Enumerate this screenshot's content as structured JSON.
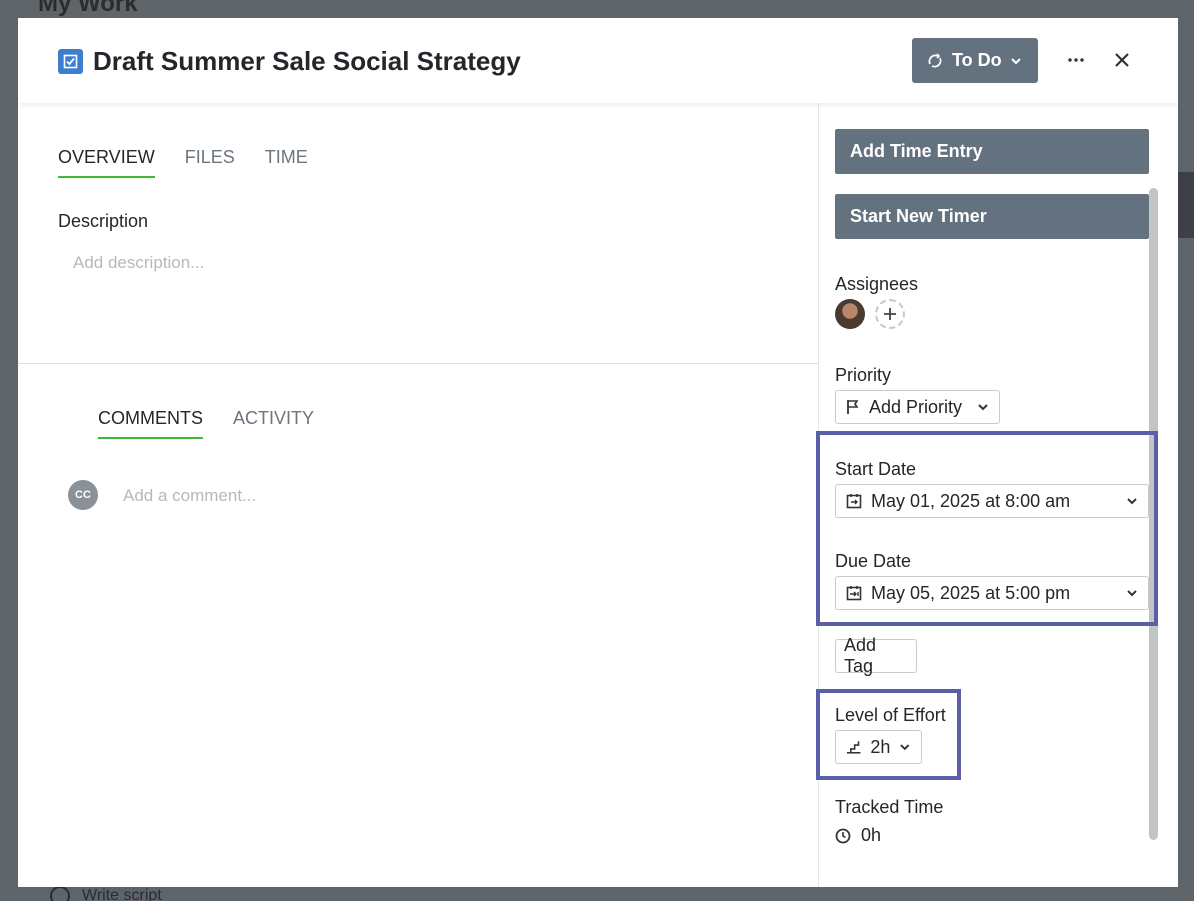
{
  "background": {
    "page_title": "My Work",
    "task_item": "Write script"
  },
  "modal": {
    "title": "Draft Summer Sale Social Strategy",
    "status": "To Do",
    "tabs": [
      "OVERVIEW",
      "FILES",
      "TIME"
    ],
    "description": {
      "label": "Description",
      "placeholder": "Add description..."
    },
    "comment_tabs": [
      "COMMENTS",
      "ACTIVITY"
    ],
    "comment": {
      "avatar_initials": "CC",
      "placeholder": "Add a comment..."
    }
  },
  "sidebar": {
    "add_time_entry": "Add Time Entry",
    "start_new_timer": "Start New Timer",
    "assignees_label": "Assignees",
    "priority_label": "Priority",
    "priority_value": "Add Priority",
    "start_date_label": "Start Date",
    "start_date_value": "May 01, 2025 at 8:00 am",
    "due_date_label": "Due Date",
    "due_date_value": "May 05, 2025 at 5:00 pm",
    "add_tag": "Add Tag",
    "effort_label": "Level of Effort",
    "effort_value": "2h",
    "tracked_label": "Tracked Time",
    "tracked_value": "0h"
  },
  "colors": {
    "accent_tab": "#3fb83a",
    "button": "#64717f",
    "highlight": "#5a5fa8",
    "task_icon": "#3d7fce"
  }
}
